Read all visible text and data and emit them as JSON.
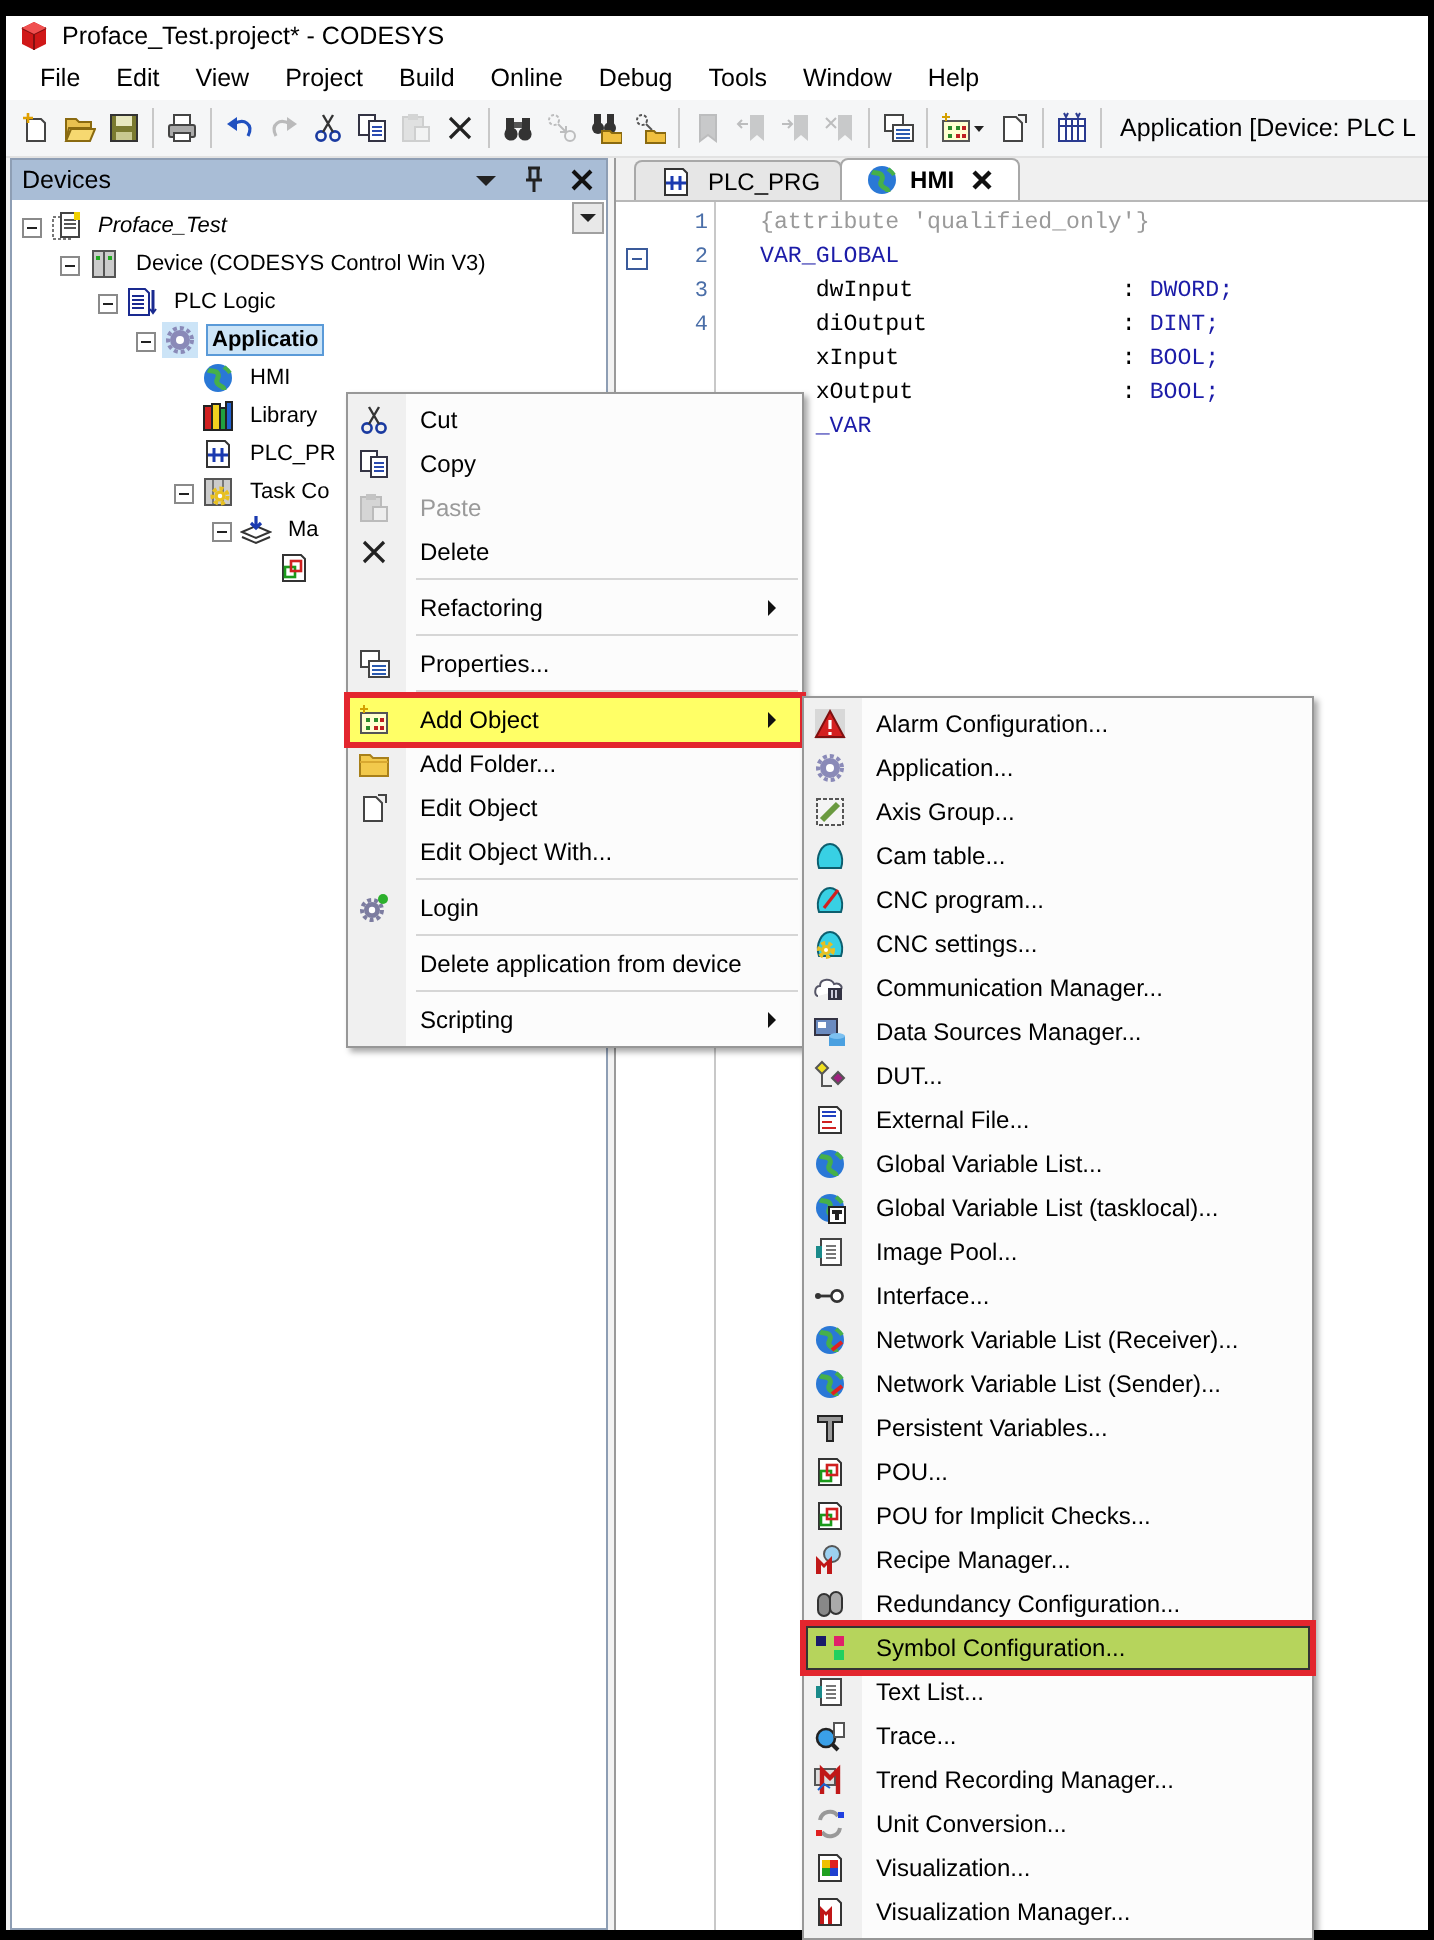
{
  "window": {
    "title": "Proface_Test.project* - CODESYS"
  },
  "menu_bar": [
    "File",
    "Edit",
    "View",
    "Project",
    "Build",
    "Online",
    "Debug",
    "Tools",
    "Window",
    "Help"
  ],
  "toolbar": {
    "buttons": [
      {
        "kind": "button",
        "disabled": false
      },
      {
        "kind": "button",
        "disabled": false
      },
      {
        "kind": "button",
        "disabled": false
      },
      {
        "kind": "separator"
      },
      {
        "kind": "button",
        "disabled": false
      },
      {
        "kind": "separator"
      },
      {
        "kind": "button",
        "disabled": false
      },
      {
        "kind": "button",
        "disabled": true
      },
      {
        "kind": "button",
        "disabled": false
      },
      {
        "kind": "button",
        "disabled": false
      },
      {
        "kind": "button",
        "disabled": true
      },
      {
        "kind": "button",
        "disabled": false
      },
      {
        "kind": "separator"
      },
      {
        "kind": "button",
        "disabled": false
      },
      {
        "kind": "button",
        "disabled": true
      },
      {
        "kind": "button",
        "disabled": false
      },
      {
        "kind": "button",
        "disabled": false
      },
      {
        "kind": "separator"
      },
      {
        "kind": "button",
        "disabled": true
      },
      {
        "kind": "button",
        "disabled": true
      },
      {
        "kind": "button",
        "disabled": true
      },
      {
        "kind": "button",
        "disabled": true
      },
      {
        "kind": "separator"
      },
      {
        "kind": "button",
        "disabled": false
      },
      {
        "kind": "separator"
      },
      {
        "kind": "dropdown",
        "disabled": false
      },
      {
        "kind": "button",
        "disabled": false
      },
      {
        "kind": "separator"
      },
      {
        "kind": "button",
        "disabled": false
      },
      {
        "kind": "separator"
      }
    ],
    "active_application": "Application [Device: PLC L"
  },
  "devices": {
    "title": "Devices",
    "tree": [
      {
        "label": "Proface_Test",
        "kind": "project",
        "expanded": true,
        "selected": false,
        "active": false,
        "children": [
          {
            "label": "Device (CODESYS Control Win V3)",
            "kind": "device",
            "expanded": true,
            "selected": false,
            "active": false,
            "children": [
              {
                "label": "PLC Logic",
                "kind": "plc-logic",
                "expanded": true,
                "selected": false,
                "active": false,
                "children": [
                  {
                    "label": "Applicatio",
                    "kind": "application",
                    "expanded": true,
                    "selected": true,
                    "active": true,
                    "children": [
                      {
                        "label": "HMI",
                        "kind": "gvl",
                        "selected": false,
                        "active": false
                      },
                      {
                        "label": "Library",
                        "kind": "library",
                        "selected": false,
                        "active": false
                      },
                      {
                        "label": "PLC_PR",
                        "kind": "pou",
                        "selected": false,
                        "active": false
                      },
                      {
                        "label": "Task Co",
                        "kind": "task-config",
                        "expanded": true,
                        "selected": false,
                        "active": false,
                        "children": [
                          {
                            "label": "Ma",
                            "kind": "task",
                            "expanded": true,
                            "selected": false,
                            "active": false,
                            "children": [
                              {
                                "kind": "pou-call",
                                "selected": false
                              }
                            ]
                          }
                        ]
                      }
                    ]
                  }
                ]
              }
            ]
          }
        ]
      }
    ]
  },
  "editor": {
    "tabs": [
      {
        "label": "PLC_PRG",
        "selected": false,
        "closable": false
      },
      {
        "label": "HMI",
        "selected": true,
        "closable": true
      }
    ],
    "lines": [
      {
        "number": "1",
        "fold": false,
        "segments": [
          {
            "text": "{attribute 'qualified_only'}",
            "kind": "pragma"
          }
        ]
      },
      {
        "number": "2",
        "fold": true,
        "segments": [
          {
            "text": "VAR_GLOBAL",
            "kind": "keyword"
          }
        ]
      },
      {
        "number": "3",
        "fold": false,
        "segments": [
          {
            "text": "    dwInput               : ",
            "kind": "plain"
          },
          {
            "text": "DWORD;",
            "kind": "type"
          }
        ]
      },
      {
        "number": "4",
        "fold": false,
        "segments": [
          {
            "text": "    diOutput              : ",
            "kind": "plain"
          },
          {
            "text": "DINT;",
            "kind": "type"
          }
        ]
      },
      {
        "segments": [
          {
            "text": "    xInput                : ",
            "kind": "plain"
          },
          {
            "text": "BOOL;",
            "kind": "type"
          }
        ]
      },
      {
        "segments": [
          {
            "text": "    xOutput               : ",
            "kind": "plain"
          },
          {
            "text": "BOOL;",
            "kind": "type"
          }
        ]
      },
      {
        "segments": [
          {
            "text": "    _VAR",
            "kind": "keyword"
          }
        ]
      }
    ]
  },
  "context_menu": {
    "items": [
      {
        "kind": "item",
        "label": "Cut",
        "disabled": false,
        "selected": false,
        "submenu": false,
        "outlined": false
      },
      {
        "kind": "item",
        "label": "Copy",
        "disabled": false,
        "selected": false,
        "submenu": false,
        "outlined": false
      },
      {
        "kind": "item",
        "label": "Paste",
        "disabled": true,
        "selected": false,
        "submenu": false,
        "outlined": false
      },
      {
        "kind": "item",
        "label": "Delete",
        "disabled": false,
        "selected": false,
        "submenu": false,
        "outlined": false
      },
      {
        "kind": "separator"
      },
      {
        "kind": "item",
        "label": "Refactoring",
        "disabled": false,
        "selected": false,
        "submenu": true,
        "outlined": false
      },
      {
        "kind": "separator"
      },
      {
        "kind": "item",
        "label": "Properties...",
        "disabled": false,
        "selected": false,
        "submenu": false,
        "outlined": false
      },
      {
        "kind": "separator"
      },
      {
        "kind": "item",
        "label": "Add Object",
        "disabled": false,
        "selected": true,
        "submenu": true,
        "outlined": true
      },
      {
        "kind": "item",
        "label": "Add Folder...",
        "disabled": false,
        "selected": false,
        "submenu": false,
        "outlined": false
      },
      {
        "kind": "item",
        "label": "Edit Object",
        "disabled": false,
        "selected": false,
        "submenu": false,
        "outlined": false
      },
      {
        "kind": "item",
        "label": "Edit Object With...",
        "disabled": false,
        "selected": false,
        "submenu": false,
        "outlined": false
      },
      {
        "kind": "separator"
      },
      {
        "kind": "item",
        "label": "Login",
        "disabled": false,
        "selected": false,
        "submenu": false,
        "outlined": false
      },
      {
        "kind": "separator"
      },
      {
        "kind": "item",
        "label": "Delete application from device",
        "disabled": false,
        "selected": false,
        "submenu": false,
        "outlined": false
      },
      {
        "kind": "separator"
      },
      {
        "kind": "item",
        "label": "Scripting",
        "disabled": false,
        "selected": false,
        "submenu": true,
        "outlined": false
      }
    ]
  },
  "submenu": {
    "items": [
      {
        "kind": "item",
        "label": "Alarm Configuration...",
        "disabled": false,
        "selected": false,
        "submenu": false,
        "outlined": false
      },
      {
        "kind": "item",
        "label": "Application...",
        "disabled": false,
        "selected": false,
        "submenu": false,
        "outlined": false
      },
      {
        "kind": "item",
        "label": "Axis Group...",
        "disabled": false,
        "selected": false,
        "submenu": false,
        "outlined": false
      },
      {
        "kind": "item",
        "label": "Cam table...",
        "disabled": false,
        "selected": false,
        "submenu": false,
        "outlined": false
      },
      {
        "kind": "item",
        "label": "CNC program...",
        "disabled": false,
        "selected": false,
        "submenu": false,
        "outlined": false
      },
      {
        "kind": "item",
        "label": "CNC settings...",
        "disabled": false,
        "selected": false,
        "submenu": false,
        "outlined": false
      },
      {
        "kind": "item",
        "label": "Communication Manager...",
        "disabled": false,
        "selected": false,
        "submenu": false,
        "outlined": false
      },
      {
        "kind": "item",
        "label": "Data Sources Manager...",
        "disabled": false,
        "selected": false,
        "submenu": false,
        "outlined": false
      },
      {
        "kind": "item",
        "label": "DUT...",
        "disabled": false,
        "selected": false,
        "submenu": false,
        "outlined": false
      },
      {
        "kind": "item",
        "label": "External File...",
        "disabled": false,
        "selected": false,
        "submenu": false,
        "outlined": false
      },
      {
        "kind": "item",
        "label": "Global Variable List...",
        "disabled": false,
        "selected": false,
        "submenu": false,
        "outlined": false
      },
      {
        "kind": "item",
        "label": "Global Variable List (tasklocal)...",
        "disabled": false,
        "selected": false,
        "submenu": false,
        "outlined": false
      },
      {
        "kind": "item",
        "label": "Image Pool...",
        "disabled": false,
        "selected": false,
        "submenu": false,
        "outlined": false
      },
      {
        "kind": "item",
        "label": "Interface...",
        "disabled": false,
        "selected": false,
        "submenu": false,
        "outlined": false
      },
      {
        "kind": "item",
        "label": "Network Variable List (Receiver)...",
        "disabled": false,
        "selected": false,
        "submenu": false,
        "outlined": false
      },
      {
        "kind": "item",
        "label": "Network Variable List (Sender)...",
        "disabled": false,
        "selected": false,
        "submenu": false,
        "outlined": false
      },
      {
        "kind": "item",
        "label": "Persistent Variables...",
        "disabled": false,
        "selected": false,
        "submenu": false,
        "outlined": false
      },
      {
        "kind": "item",
        "label": "POU...",
        "disabled": false,
        "selected": false,
        "submenu": false,
        "outlined": false
      },
      {
        "kind": "item",
        "label": "POU for Implicit Checks...",
        "disabled": false,
        "selected": false,
        "submenu": false,
        "outlined": false
      },
      {
        "kind": "item",
        "label": "Recipe Manager...",
        "disabled": false,
        "selected": false,
        "submenu": false,
        "outlined": false
      },
      {
        "kind": "item",
        "label": "Redundancy Configuration...",
        "disabled": false,
        "selected": false,
        "submenu": false,
        "outlined": false
      },
      {
        "kind": "item",
        "label": "Symbol Configuration...",
        "disabled": false,
        "selected": true,
        "submenu": false,
        "outlined": true
      },
      {
        "kind": "item",
        "label": "Text List...",
        "disabled": false,
        "selected": false,
        "submenu": false,
        "outlined": false
      },
      {
        "kind": "item",
        "label": "Trace...",
        "disabled": false,
        "selected": false,
        "submenu": false,
        "outlined": false
      },
      {
        "kind": "item",
        "label": "Trend Recording Manager...",
        "disabled": false,
        "selected": false,
        "submenu": false,
        "outlined": false
      },
      {
        "kind": "item",
        "label": "Unit Conversion...",
        "disabled": false,
        "selected": false,
        "submenu": false,
        "outlined": false
      },
      {
        "kind": "item",
        "label": "Visualization...",
        "disabled": false,
        "selected": false,
        "submenu": false,
        "outlined": false
      },
      {
        "kind": "item",
        "label": "Visualization Manager...",
        "disabled": false,
        "selected": false,
        "submenu": false,
        "outlined": false
      }
    ]
  }
}
